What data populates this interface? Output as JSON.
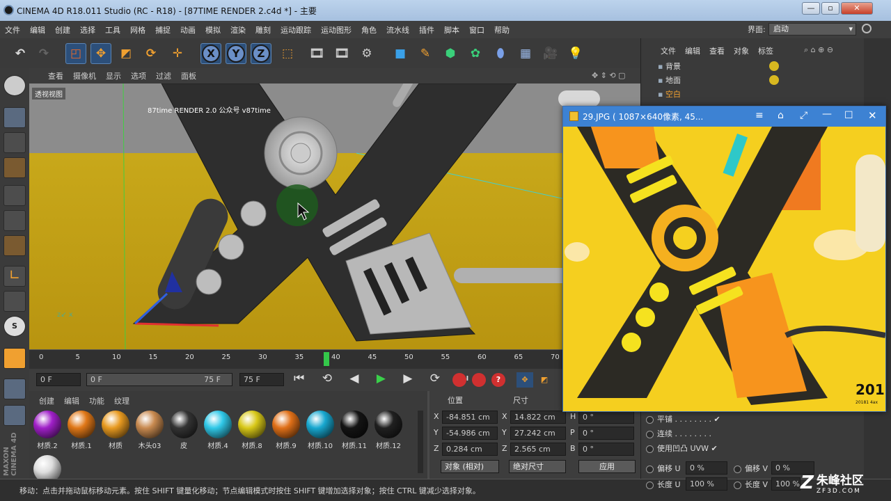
{
  "window": {
    "title": "CINEMA 4D R18.011 Studio (RC - R18) - [87TIME RENDER 2.c4d *] - 主要",
    "min": "—",
    "max": "▫",
    "close": "✕"
  },
  "menubar": [
    "文件",
    "编辑",
    "创建",
    "选择",
    "工具",
    "网格",
    "捕捉",
    "动画",
    "模拟",
    "渲染",
    "雕刻",
    "运动跟踪",
    "运动图形",
    "角色",
    "流水线",
    "插件",
    "脚本",
    "窗口",
    "帮助"
  ],
  "layout": {
    "label": "界面:",
    "value": "启动"
  },
  "viewport": {
    "menu": [
      "查看",
      "摄像机",
      "显示",
      "选项",
      "过滤",
      "面板"
    ],
    "label": "透视视图",
    "overlay": "87time RENDER 2.0 公众号 v87time"
  },
  "timeline": {
    "ticks": [
      "0",
      "5",
      "10",
      "15",
      "20",
      "25",
      "30",
      "35",
      "40",
      "45",
      "50",
      "55",
      "60",
      "65",
      "70"
    ],
    "current": "40",
    "current_fraction": 0.533
  },
  "transport": {
    "start": "0 F",
    "range_start": "0 F",
    "range_end": "75 F",
    "end": "75 F"
  },
  "materials": {
    "tabs": [
      "创建",
      "编辑",
      "功能",
      "纹理"
    ],
    "items": [
      {
        "name": "材质.2",
        "color": "#a020c8"
      },
      {
        "name": "材质.1",
        "color": "#e07818"
      },
      {
        "name": "材质",
        "color": "#e89a20"
      },
      {
        "name": "木头03",
        "color": "#c88a50"
      },
      {
        "name": "皮",
        "color": "#333333"
      },
      {
        "name": "材质.4",
        "color": "#30c8e8"
      },
      {
        "name": "材质.8",
        "color": "#d8c818"
      },
      {
        "name": "材质.9",
        "color": "#e07018"
      },
      {
        "name": "材质.10",
        "color": "#18a8d0"
      },
      {
        "name": "材质.11",
        "color": "#141414"
      },
      {
        "name": "材质.12",
        "color": "#202020"
      },
      {
        "name": "",
        "color": "#dddddd"
      }
    ]
  },
  "coords": {
    "headers": {
      "pos": "位置",
      "size": "尺寸"
    },
    "rows": [
      {
        "axis": "X",
        "pos": "-84.851 cm",
        "saxis": "X",
        "size": "14.822 cm",
        "raxis": "H",
        "rot": "0 °"
      },
      {
        "axis": "Y",
        "pos": "-54.986 cm",
        "saxis": "Y",
        "size": "27.242 cm",
        "raxis": "P",
        "rot": "0 °"
      },
      {
        "axis": "Z",
        "pos": "0.284 cm",
        "saxis": "Z",
        "size": "2.565 cm",
        "raxis": "B",
        "rot": "0 °"
      }
    ],
    "mode": "对象 (相对)",
    "size_mode": "绝对尺寸",
    "apply": "应用"
  },
  "objects": {
    "menu": [
      "文件",
      "编辑",
      "查看",
      "对象",
      "标签"
    ],
    "items": [
      "背景",
      "地面",
      "空白"
    ]
  },
  "attributes": {
    "tile": "平铺 . . . . . . . . ✔",
    "seamless": "连续 . . . . . . . .",
    "bump": "使用凹凸 UVW ✔",
    "offset_u_label": "偏移 U",
    "offset_u": "0 %",
    "offset_v_label": "偏移 V",
    "offset_v": "0 %",
    "length_u_label": "长度 U",
    "length_u": "100 %",
    "length_v_label": "长度 V",
    "length_v": "100 %"
  },
  "image_viewer": {
    "title": "29.JPG ( 1087×640像素, 45...",
    "caption": "201",
    "subcaption": "20181 4ax"
  },
  "status": "移动：点击并拖动鼠标移动元素。按住 SHIFT 键量化移动；节点编辑模式时按住 SHIFT 键增加选择对象；按住 CTRL 键减少选择对象。",
  "watermark": {
    "brand": "朱峰社区",
    "url": "ZF3D.COM"
  },
  "maxon_logo": "MAXON CINEMA 4D"
}
